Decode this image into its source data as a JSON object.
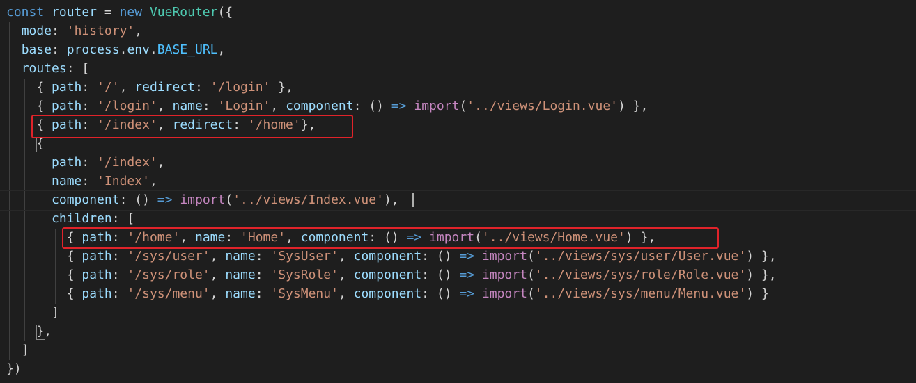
{
  "code": {
    "l1": {
      "const_kw": "const",
      "router_var": "router",
      "eq": "=",
      "new_kw": "new",
      "class_name": "VueRouter",
      "open": "({"
    },
    "l2": {
      "key": "mode",
      "colon": ":",
      "value": "'history'",
      "comma": ","
    },
    "l3": {
      "key": "base",
      "colon": ":",
      "obj": "process",
      "dot1": ".",
      "prop": "env",
      "dot2": ".",
      "const_name": "BASE_URL",
      "comma": ","
    },
    "l4": {
      "key": "routes",
      "colon": ":",
      "open": "["
    },
    "l5": {
      "open": "{",
      "path_key": "path",
      "c1": ":",
      "path_val": "'/'",
      "comma1": ",",
      "redirect_key": "redirect",
      "c2": ":",
      "redirect_val": "'/login'",
      "close": "},"
    },
    "l6": {
      "open": "{",
      "path_key": "path",
      "c1": ":",
      "path_val": "'/login'",
      "comma1": ",",
      "name_key": "name",
      "c2": ":",
      "name_val": "'Login'",
      "comma2": ",",
      "component_key": "component",
      "c3": ":",
      "parens": "()",
      "arrow": "=>",
      "import_kw": "import",
      "open_paren": "(",
      "import_val": "'../views/Login.vue'",
      "close": ") },"
    },
    "l7": {
      "open": "{",
      "path_key": "path",
      "c1": ":",
      "path_val": "'/index'",
      "comma1": ",",
      "redirect_key": "redirect",
      "c2": ":",
      "redirect_val": "'/home'",
      "close": "},"
    },
    "l8": {
      "open": "{"
    },
    "l9": {
      "key": "path",
      "colon": ":",
      "value": "'/index'",
      "comma": ","
    },
    "l10": {
      "key": "name",
      "colon": ":",
      "value": "'Index'",
      "comma": ","
    },
    "l11": {
      "key": "component",
      "colon": ":",
      "parens": "()",
      "arrow": "=>",
      "import_kw": "import",
      "open_paren": "(",
      "value": "'../views/Index.vue'",
      "close": "),"
    },
    "l12": {
      "key": "children",
      "colon": ":",
      "open": "["
    },
    "l13": {
      "open": "{",
      "path_key": "path",
      "c1": ":",
      "path_val": "'/home'",
      "comma1": ",",
      "name_key": "name",
      "c2": ":",
      "name_val": "'Home'",
      "comma2": ",",
      "component_key": "component",
      "c3": ":",
      "parens": "()",
      "arrow": "=>",
      "import_kw": "import",
      "open_paren": "(",
      "import_val": "'../views/Home.vue'",
      "close": ") },"
    },
    "l14": {
      "open": "{",
      "path_key": "path",
      "c1": ":",
      "path_val": "'/sys/user'",
      "comma1": ",",
      "name_key": "name",
      "c2": ":",
      "name_val": "'SysUser'",
      "comma2": ",",
      "component_key": "component",
      "c3": ":",
      "parens": "()",
      "arrow": "=>",
      "import_kw": "import",
      "open_paren": "(",
      "import_val": "'../views/sys/user/User.vue'",
      "close": ") },"
    },
    "l15": {
      "open": "{",
      "path_key": "path",
      "c1": ":",
      "path_val": "'/sys/role'",
      "comma1": ",",
      "name_key": "name",
      "c2": ":",
      "name_val": "'SysRole'",
      "comma2": ",",
      "component_key": "component",
      "c3": ":",
      "parens": "()",
      "arrow": "=>",
      "import_kw": "import",
      "open_paren": "(",
      "import_val": "'../views/sys/role/Role.vue'",
      "close": ") },"
    },
    "l16": {
      "open": "{",
      "path_key": "path",
      "c1": ":",
      "path_val": "'/sys/menu'",
      "comma1": ",",
      "name_key": "name",
      "c2": ":",
      "name_val": "'SysMenu'",
      "comma2": ",",
      "component_key": "component",
      "c3": ":",
      "parens": "()",
      "arrow": "=>",
      "import_kw": "import",
      "open_paren": "(",
      "import_val": "'../views/sys/menu/Menu.vue'",
      "close": ") }"
    },
    "l17": {
      "close": "]"
    },
    "l18": {
      "close": "},"
    },
    "l19": {
      "close": "]"
    },
    "l20": {
      "close": "})"
    }
  },
  "colors": {
    "background": "#1e1e1e",
    "keyword": "#569cd6",
    "variable": "#9cdcfe",
    "class": "#4ec9b0",
    "string": "#ce9178",
    "control": "#c586c0",
    "highlight_box": "#e0232a"
  }
}
